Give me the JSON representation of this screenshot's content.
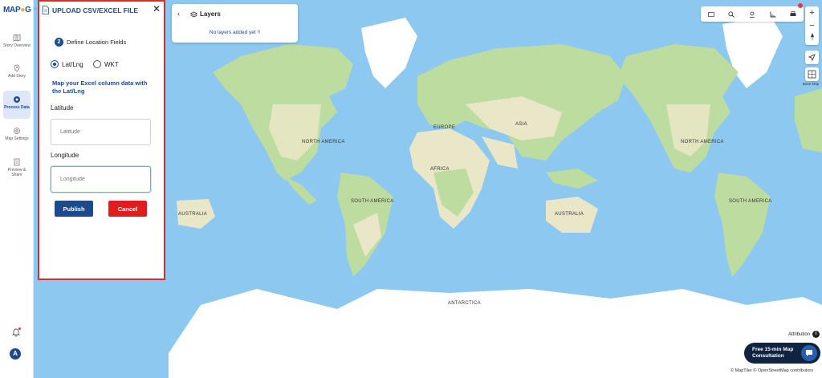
{
  "app": {
    "logo_main": "MAP",
    "logo_tail": "G"
  },
  "sidebar": {
    "items": [
      {
        "label": "Story Overview",
        "icon": "map-icon"
      },
      {
        "label": "Add Story",
        "icon": "location-pin-icon"
      },
      {
        "label": "Process Data",
        "icon": "gear-icon"
      },
      {
        "label": "Map Settings",
        "icon": "settings-icon"
      },
      {
        "label": "Preview & Share",
        "icon": "document-icon"
      }
    ],
    "avatar_letter": "A"
  },
  "panel": {
    "title": "UPLOAD CSV/EXCEL FILE",
    "close": "✕",
    "step_number": "2",
    "step_label": "Define Location Fields",
    "radio_latlng": "Lat/Lng",
    "radio_wkt": "WKT",
    "hint": "Map your Excel column data with the Lat/Lng",
    "latitude_label": "Latitude",
    "latitude_placeholder": "Latitude",
    "longitude_label": "Longitude",
    "longitude_placeholder": "Longitude",
    "publish": "Publish",
    "cancel": "Cancel"
  },
  "layers": {
    "title": "Layers",
    "back": "‹",
    "empty": "No layers added yet !!"
  },
  "map": {
    "labels": {
      "na_left": "NORTH AMERICA",
      "sa_left": "SOUTH AMERICA",
      "aus_left": "AUSTRALIA",
      "europe": "EUROPE",
      "asia": "ASIA",
      "africa": "AFRICA",
      "aus_right": "AUSTRALIA",
      "na_right": "NORTH AMERICA",
      "sa_right": "SOUTH AMERICA",
      "antarctica": "ANTARCTICA"
    },
    "colors": {
      "ocean": "#8cc8f0",
      "land": "#eae6c8",
      "forest": "#bcdca0",
      "ice": "#ffffff"
    }
  },
  "controls": {
    "zoom_in": "+",
    "zoom_out": "−",
    "basemap": "Base Map"
  },
  "footer": {
    "attribution": "Attribution",
    "attribution_icon": "i",
    "consult": "Free 15-min Map Consultation",
    "credits": "© MapTiler © OpenStreetMap contributors"
  }
}
